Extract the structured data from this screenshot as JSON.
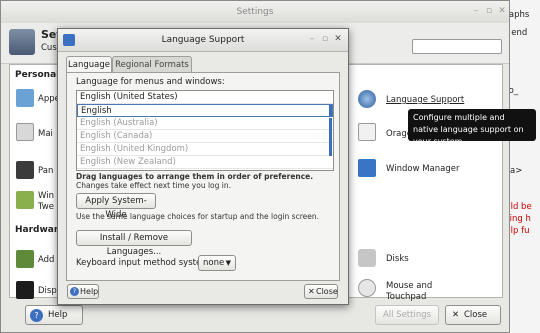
{
  "background": {
    "lines": [
      "graphs",
      "at end",
      "_so_",
      "ke",
      "</a>",
      "ould be",
      "cking h",
      "help fu"
    ]
  },
  "settings": {
    "title": "Settings",
    "header_title": "Set",
    "header_subtitle": "Cus",
    "categories": {
      "personal": "Personal",
      "hardware": "Hardware"
    },
    "left_items": [
      "Appe",
      "Mai",
      "Pan",
      "Win",
      "Twe",
      "Add",
      "Disp"
    ],
    "right_items": [
      {
        "label": "Language Support",
        "icon": "globe-icon"
      },
      {
        "label": "Orage",
        "icon": "calendar-icon"
      },
      {
        "label": "Window Manager",
        "icon": "window-manager-icon"
      },
      {
        "label": "Disks",
        "icon": "disk-icon"
      },
      {
        "label": "Mouse and Touchpad",
        "icon": "mouse-icon"
      }
    ],
    "tooltip": "Configure multiple and native language support on your system",
    "help_label": "Help",
    "all_settings_label": "All Settings",
    "close_label": "Close"
  },
  "dialog": {
    "title": "Language Support",
    "tabs": [
      "Language",
      "Regional Formats"
    ],
    "list_label": "Language for menus and windows:",
    "languages": [
      {
        "name": "English (United States)",
        "state": "normal"
      },
      {
        "name": "English",
        "state": "selected"
      },
      {
        "name": "English (Australia)",
        "state": "dim"
      },
      {
        "name": "English (Canada)",
        "state": "dim"
      },
      {
        "name": "English (United Kingdom)",
        "state": "dim"
      },
      {
        "name": "English (New Zealand)",
        "state": "dim"
      }
    ],
    "drag_hint_bold": "Drag languages to arrange them in order of preference.",
    "drag_hint": "Changes take effect next time you log in.",
    "apply_label": "Apply System-Wide",
    "apply_hint": "Use the same language choices for startup and the login screen.",
    "install_label": "Install / Remove Languages...",
    "keyboard_label": "Keyboard input method system:",
    "keyboard_value": "none",
    "help_label": "Help",
    "close_label": "Close"
  }
}
